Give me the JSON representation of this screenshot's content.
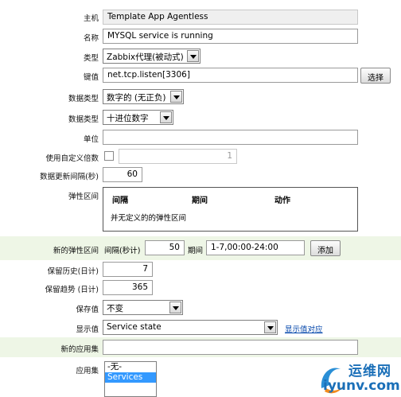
{
  "form": {
    "host": {
      "label": "主机",
      "value": "Template App Agentless"
    },
    "name": {
      "label": "名称",
      "value": "MYSQL service is running"
    },
    "type": {
      "label": "类型",
      "value": "Zabbix代理(被动式)"
    },
    "key": {
      "label": "键值",
      "value": "net.tcp.listen[3306]",
      "select_button": "选择"
    },
    "value_type": {
      "label": "数据类型",
      "value": "数字的 (无正负)"
    },
    "data_type": {
      "label": "数据类型",
      "value": "十进位数字"
    },
    "units": {
      "label": "单位",
      "value": ""
    },
    "multiplier": {
      "label": "使用自定义倍数",
      "value": "1"
    },
    "update_interval": {
      "label": "数据更新间隔(秒)",
      "value": "60"
    },
    "flex_intervals": {
      "label": "弹性区间",
      "headers": [
        "间隔",
        "期间",
        "动作"
      ],
      "empty_text": "并无定义的的弹性区间"
    },
    "new_flex_interval": {
      "label": "新的弹性区间",
      "interval_label": "间隔(秒计)",
      "interval_value": "50",
      "period_label": "期间",
      "period_value": "1-7,00:00-24:00",
      "add_button": "添加"
    },
    "history": {
      "label": "保留历史(日计)",
      "value": "7"
    },
    "trends": {
      "label": "保留趋势 (日计)",
      "value": "365"
    },
    "store_value": {
      "label": "保存值",
      "value": "不变"
    },
    "show_value": {
      "label": "显示值",
      "value": "Service state",
      "mapping_link": "显示值对应"
    },
    "new_application": {
      "label": "新的应用集",
      "value": ""
    },
    "applications": {
      "label": "应用集",
      "options": [
        "-无-",
        "Services"
      ],
      "selected": "Services"
    }
  },
  "watermark": {
    "brand": "运维网",
    "url": "iyunv.com"
  }
}
